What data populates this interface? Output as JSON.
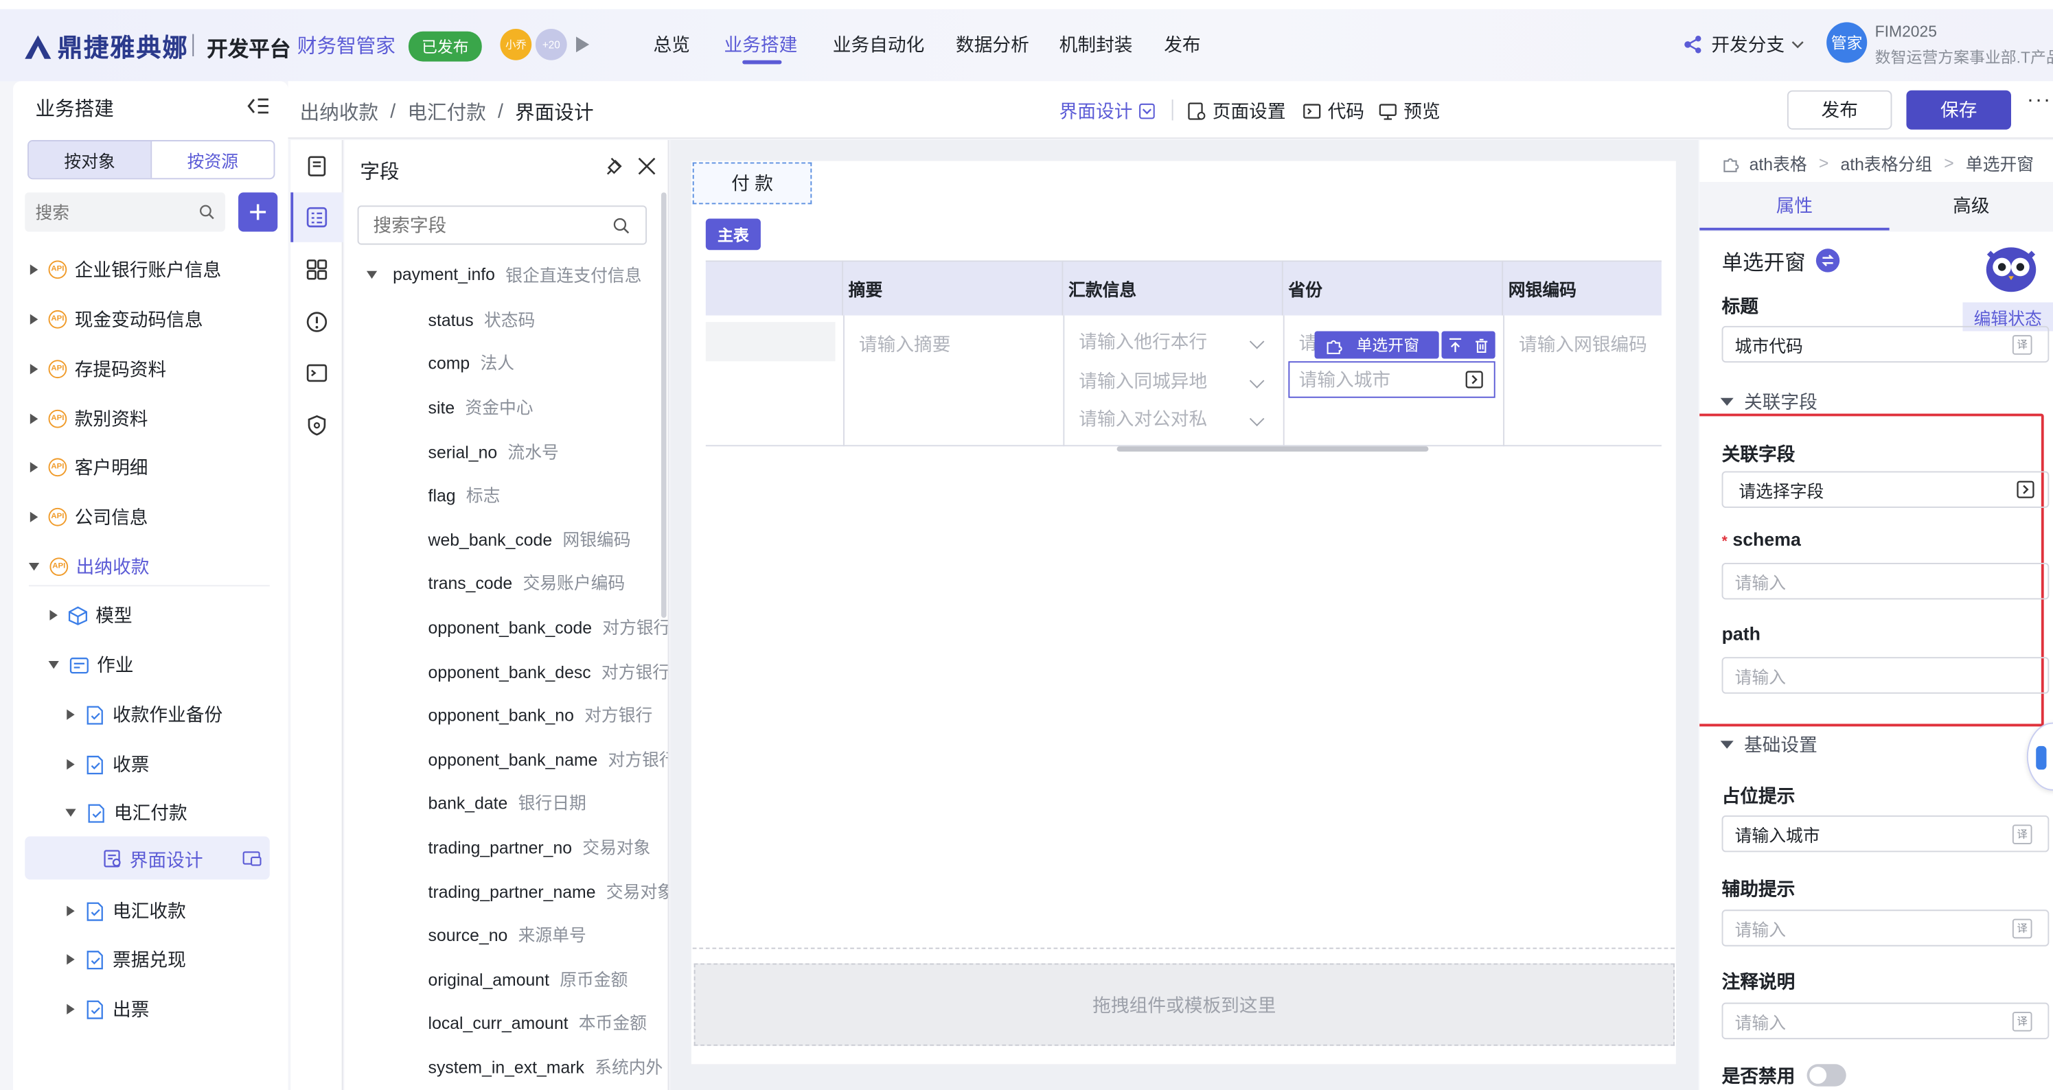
{
  "topbar": {
    "logo_text": "鼎捷雅典娜",
    "platform": "开发平台",
    "app_name": "财务智管家",
    "status_badge": "已发布",
    "avatar_small_1": "小乔",
    "avatar_small_2": "+20",
    "nav": [
      "总览",
      "业务搭建",
      "业务自动化",
      "数据分析",
      "机制封装",
      "发布"
    ],
    "active_nav": "业务搭建",
    "branch_label": "开发分支",
    "user_avatar": "管家",
    "user_name": "FIM2025",
    "user_org": "数智运营方案事业部.T产品"
  },
  "sidebar": {
    "title": "业务搭建",
    "seg_object": "按对象",
    "seg_resource": "按资源",
    "search_placeholder": "搜索",
    "api_badge": "API",
    "tree": [
      {
        "label": "企业银行账户信息"
      },
      {
        "label": "现金变动码信息"
      },
      {
        "label": "存提码资料"
      },
      {
        "label": "款别资料"
      },
      {
        "label": "客户明细"
      },
      {
        "label": "公司信息"
      },
      {
        "label": "出纳收款"
      },
      {
        "label": "模型"
      },
      {
        "label": "作业"
      },
      {
        "label": "收款作业备份"
      },
      {
        "label": "收票"
      },
      {
        "label": "电汇付款"
      },
      {
        "label": "界面设计"
      },
      {
        "label": "电汇收款"
      },
      {
        "label": "票据兑现"
      },
      {
        "label": "出票"
      }
    ]
  },
  "breadcrumb": {
    "items": [
      "出纳收款",
      "电汇付款",
      "界面设计"
    ],
    "separator": "/"
  },
  "toolbar": {
    "design": "界面设计",
    "page_settings": "页面设置",
    "code": "代码",
    "preview": "预览",
    "publish": "发布",
    "save": "保存",
    "more": "···"
  },
  "fields_panel": {
    "title": "字段",
    "search_placeholder": "搜索字段",
    "group": {
      "name": "payment_info",
      "cn": "银企直连支付信息"
    },
    "fields": [
      {
        "name": "status",
        "cn": "状态码"
      },
      {
        "name": "comp",
        "cn": "法人"
      },
      {
        "name": "site",
        "cn": "资金中心"
      },
      {
        "name": "serial_no",
        "cn": "流水号"
      },
      {
        "name": "flag",
        "cn": "标志"
      },
      {
        "name": "web_bank_code",
        "cn": "网银编码"
      },
      {
        "name": "trans_code",
        "cn": "交易账户编码"
      },
      {
        "name": "opponent_bank_code",
        "cn": "对方银行"
      },
      {
        "name": "opponent_bank_desc",
        "cn": "对方银行"
      },
      {
        "name": "opponent_bank_no",
        "cn": "对方银行"
      },
      {
        "name": "opponent_bank_name",
        "cn": "对方银行"
      },
      {
        "name": "bank_date",
        "cn": "银行日期"
      },
      {
        "name": "trading_partner_no",
        "cn": "交易对象"
      },
      {
        "name": "trading_partner_name",
        "cn": "交易对象"
      },
      {
        "name": "source_no",
        "cn": "来源单号"
      },
      {
        "name": "original_amount",
        "cn": "原币金额"
      },
      {
        "name": "local_curr_amount",
        "cn": "本币金额"
      },
      {
        "name": "system_in_ext_mark",
        "cn": "系统内外"
      }
    ]
  },
  "canvas": {
    "tab_label": "付 款",
    "main_table_badge": "主表",
    "columns": [
      "摘要",
      "汇款信息",
      "省份",
      "网银编码"
    ],
    "summary_placeholder": "请输入摘要",
    "remit_placeholders": [
      "请输入他行本行",
      "请输入同城异地",
      "请输入对公对私"
    ],
    "province_placeholder_peek": "请",
    "city_placeholder": "请输入城市",
    "web_code_placeholder": "请输入网银编码",
    "component_chip": "单选开窗",
    "drop_zone_text": "拖拽组件或模板到这里"
  },
  "props": {
    "breadcrumb": [
      "ath表格",
      "ath表格分组",
      "单选开窗"
    ],
    "tab_properties": "属性",
    "tab_advanced": "高级",
    "component_name": "单选开窗",
    "edit_state": "编辑状态",
    "title_label": "标题",
    "title_value": "城市代码",
    "section_related": "关联字段",
    "related_field_label": "关联字段",
    "related_field_placeholder": "请选择字段",
    "schema_label": "schema",
    "schema_placeholder": "请输入",
    "path_label": "path",
    "path_placeholder": "请输入",
    "section_basic": "基础设置",
    "placeholder_label": "占位提示",
    "placeholder_value": "请输入城市",
    "help_label": "辅助提示",
    "help_placeholder": "请输入",
    "note_label": "注释说明",
    "note_placeholder": "请输入",
    "disabled_label": "是否禁用",
    "trans_icon_text": "译"
  },
  "colors": {
    "accent": "#5b5bd6",
    "highlight_box": "#e0323c",
    "api_orange": "#f09b2a",
    "green": "#3aa64a"
  }
}
